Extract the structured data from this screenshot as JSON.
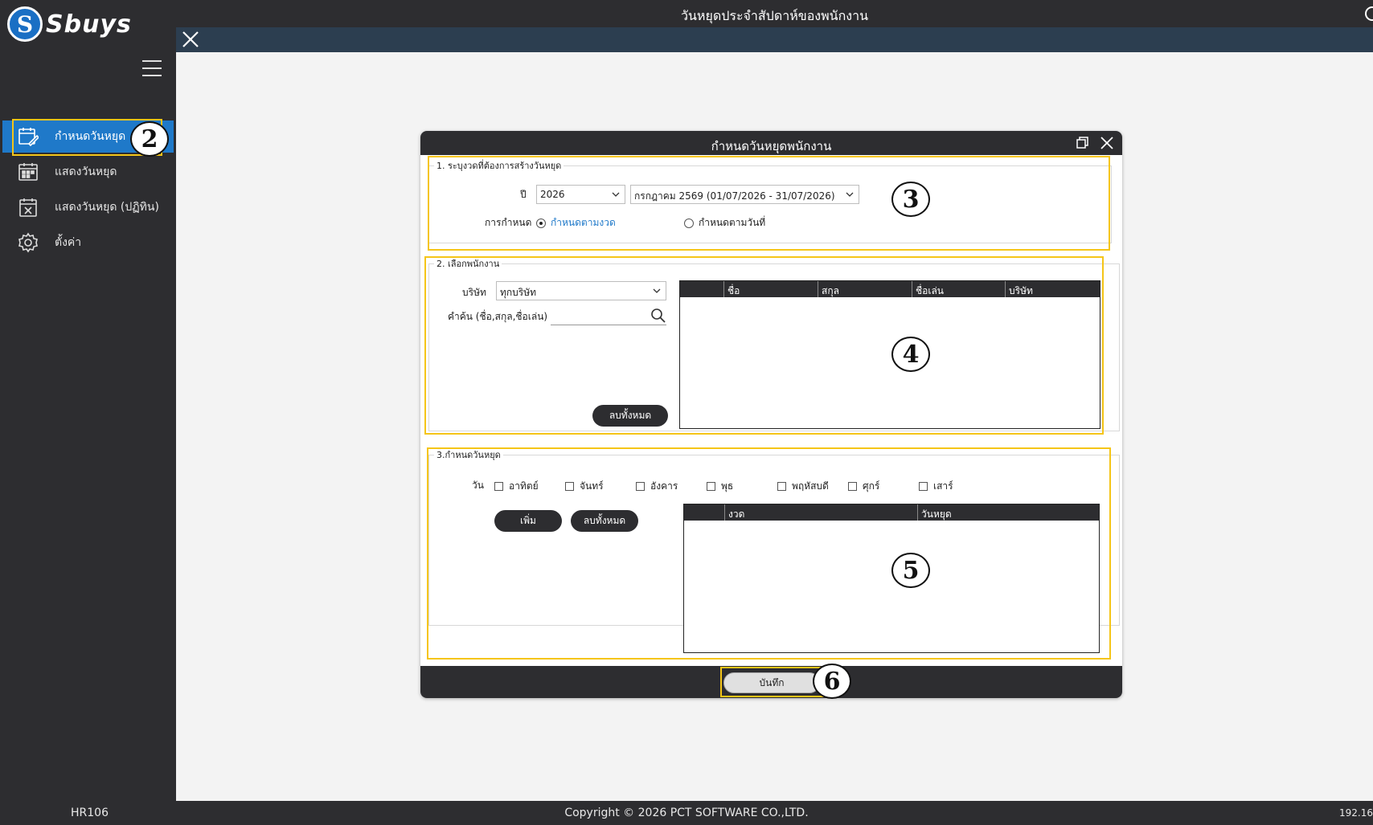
{
  "app": {
    "logo_letter": "S",
    "logo_text": "Sbuys",
    "window_title": "วันหยุดประจำสัปดาห์ของพนักงาน"
  },
  "sidebar": {
    "items": [
      {
        "label": "กำหนดวันหยุด",
        "icon": "calendar-edit-icon",
        "active": true
      },
      {
        "label": "แสดงวันหยุด",
        "icon": "calendar-grid-icon",
        "active": false
      },
      {
        "label": "แสดงวันหยุด (ปฏิทิน)",
        "icon": "calendar-x-icon",
        "active": false
      },
      {
        "label": "ตั้งค่า",
        "icon": "gear-icon",
        "active": false
      }
    ]
  },
  "dialog": {
    "title": "กำหนดวันหยุดพนักงาน",
    "section1": {
      "legend": "1. ระบุงวดที่ต้องการสร้างวันหยุด",
      "year_label": "ปี",
      "year_value": "2026",
      "period_value": "กรกฎาคม 2569 (01/07/2026 - 31/07/2026)",
      "mode_label": "การกำหนด",
      "radio_period": "กำหนดตามงวด",
      "radio_date": "กำหนดตามวันที่"
    },
    "section2": {
      "legend": "2. เลือกพนักงาน",
      "company_label": "บริษัท",
      "company_value": "ทุกบริษัท",
      "search_label": "คำค้น (ชื่อ,สกุล,ชื่อเล่น)",
      "search_value": "",
      "clear_all": "ลบทั้งหมด",
      "columns": [
        "",
        "ชื่อ",
        "สกุล",
        "ชื่อเล่น",
        "บริษัท"
      ]
    },
    "section3": {
      "legend": "3.กำหนดวันหยุด",
      "day_label": "วัน",
      "days": [
        "อาทิตย์",
        "จันทร์",
        "อังคาร",
        "พุธ",
        "พฤหัสบดี",
        "ศุกร์",
        "เสาร์"
      ],
      "add": "เพิ่ม",
      "clear_all": "ลบทั้งหมด",
      "columns": [
        "",
        "งวด",
        "วันหยุด"
      ]
    },
    "save": "บันทึก"
  },
  "annotations": [
    "2",
    "3",
    "4",
    "5",
    "6"
  ],
  "footer": {
    "code": "HR106",
    "copyright": "Copyright © 2026 PCT SOFTWARE CO.,LTD.",
    "ip": "192.16"
  },
  "colors": {
    "dark": "#2d2d30",
    "accent": "#1f79c9",
    "highlight": "#f5c518"
  }
}
